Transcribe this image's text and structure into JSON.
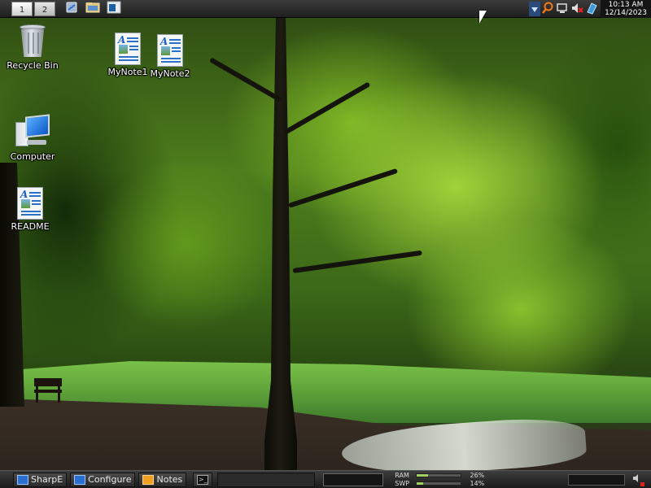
{
  "top_panel": {
    "desktops": [
      {
        "label": "1",
        "active": true
      },
      {
        "label": "2",
        "active": false
      }
    ],
    "launchers": [
      "file-manager-icon",
      "folder-icon",
      "window-icon"
    ],
    "tray_icons": [
      "dropdown-arrow-icon",
      "search-icon",
      "network-icon",
      "volume-muted-icon",
      "package-icon"
    ],
    "clock": {
      "time": "10:13 AM",
      "date": "12/14/2023"
    }
  },
  "desktop_icons": [
    {
      "label": "Recycle Bin",
      "icon": "recycle-bin-icon"
    },
    {
      "label": "Computer",
      "icon": "computer-icon"
    },
    {
      "label": "README",
      "icon": "document-icon"
    },
    {
      "label": "MyNote1",
      "icon": "document-icon"
    },
    {
      "label": "MyNote2",
      "icon": "document-icon"
    }
  ],
  "taskbar": {
    "tasks": [
      {
        "label": "SharpE",
        "icon": "display-icon"
      },
      {
        "label": "Configure",
        "icon": "display-icon"
      },
      {
        "label": "Notes",
        "icon": "notes-icon"
      },
      {
        "label": "",
        "icon": "terminal-icon"
      }
    ],
    "meters": [
      {
        "name": "RAM",
        "percent_text": "26%",
        "level": 26
      },
      {
        "name": "SWP",
        "percent_text": "14%",
        "level": 14
      }
    ],
    "speaker_icon": "speaker-muted-icon"
  },
  "colors": {
    "panel_bg": "#1f1f1f",
    "search_accent": "#f07a1a",
    "meter_fill": "#9fcf5f"
  }
}
